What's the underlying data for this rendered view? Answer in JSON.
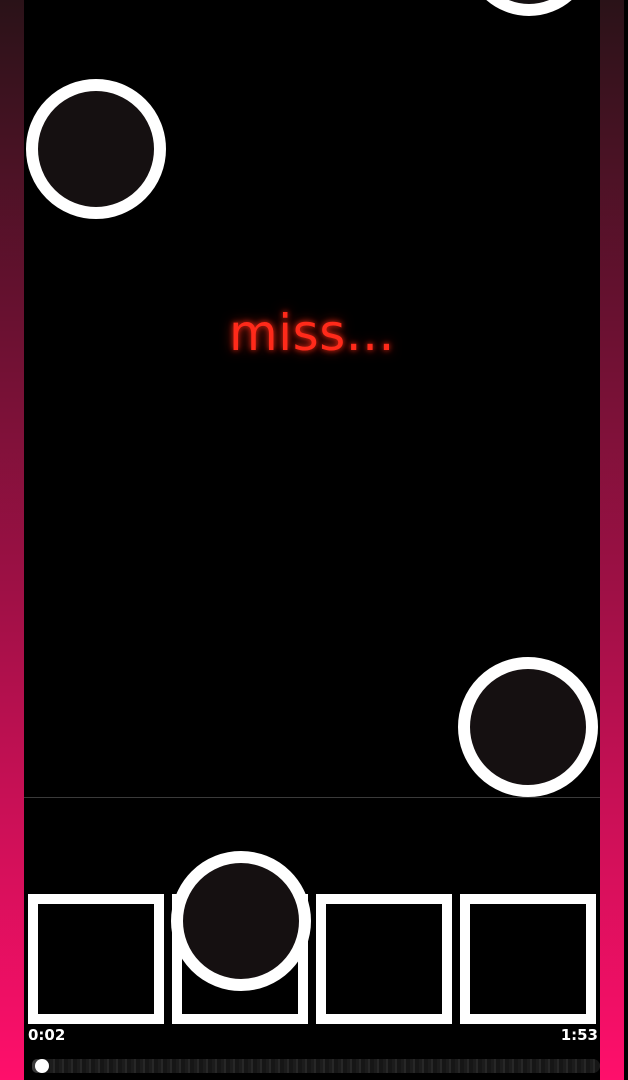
{
  "theme": {
    "border_top_color": "#2a1218",
    "border_bottom_color": "#ff0f6b",
    "judgement_color": "#ff2a1a",
    "note_fill": "#151011",
    "note_ring": "#ffffff",
    "key_border": "#ffffff"
  },
  "judgement": {
    "text": "miss..."
  },
  "lanes": {
    "count": 4,
    "keys": [
      "lane-1",
      "lane-2",
      "lane-3",
      "lane-4"
    ]
  },
  "notes": [
    {
      "lane": 1
    },
    {
      "lane": 4
    },
    {
      "lane": 2
    },
    {
      "lane": 4
    }
  ],
  "playback": {
    "elapsed": "0:02",
    "total": "1:53",
    "progress": 0.018
  }
}
